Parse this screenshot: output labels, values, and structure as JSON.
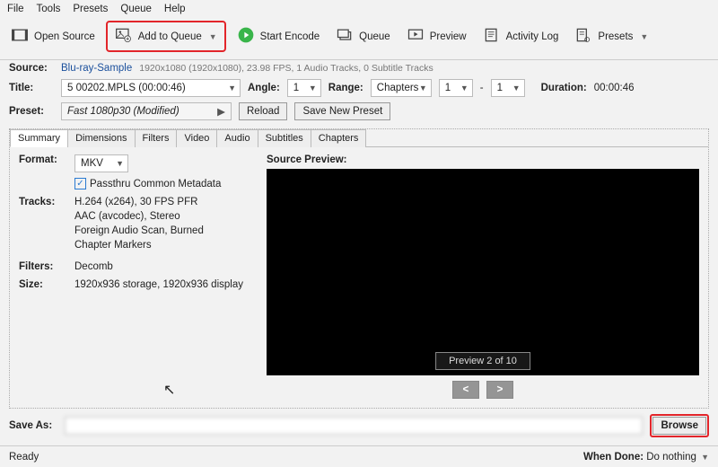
{
  "menu": {
    "file": "File",
    "tools": "Tools",
    "presets": "Presets",
    "queue": "Queue",
    "help": "Help"
  },
  "toolbar": {
    "open_source": "Open Source",
    "add_to_queue": "Add to Queue",
    "start_encode": "Start Encode",
    "queue": "Queue",
    "preview": "Preview",
    "activity_log": "Activity Log",
    "presets": "Presets"
  },
  "source": {
    "label": "Source:",
    "name": "Blu-ray-Sample",
    "info": "1920x1080 (1920x1080), 23.98 FPS, 1 Audio Tracks, 0 Subtitle Tracks"
  },
  "title": {
    "label": "Title:",
    "value": "5  00202.MPLS (00:00:46)",
    "angle_label": "Angle:",
    "angle_value": "1",
    "range_label": "Range:",
    "range_type": "Chapters",
    "range_from": "1",
    "range_dash": "-",
    "range_to": "1",
    "duration_label": "Duration:",
    "duration_value": "00:00:46"
  },
  "preset": {
    "label": "Preset:",
    "value": "Fast 1080p30  (Modified)",
    "reload": "Reload",
    "save_new": "Save New Preset"
  },
  "tabs": [
    "Summary",
    "Dimensions",
    "Filters",
    "Video",
    "Audio",
    "Subtitles",
    "Chapters"
  ],
  "summary": {
    "format_label": "Format:",
    "format_value": "MKV",
    "passthru": "Passthru Common Metadata",
    "tracks_label": "Tracks:",
    "tracks": [
      "H.264 (x264), 30 FPS PFR",
      "AAC (avcodec), Stereo",
      "Foreign Audio Scan, Burned",
      "Chapter Markers"
    ],
    "filters_label": "Filters:",
    "filters_value": "Decomb",
    "size_label": "Size:",
    "size_value": "1920x936 storage, 1920x936 display"
  },
  "preview": {
    "label": "Source Preview:",
    "badge": "Preview 2 of 10",
    "prev": "<",
    "next": ">"
  },
  "saveas": {
    "label": "Save As:",
    "browse": "Browse"
  },
  "status": {
    "ready": "Ready",
    "when_done_label": "When Done:",
    "when_done_value": "Do nothing"
  }
}
